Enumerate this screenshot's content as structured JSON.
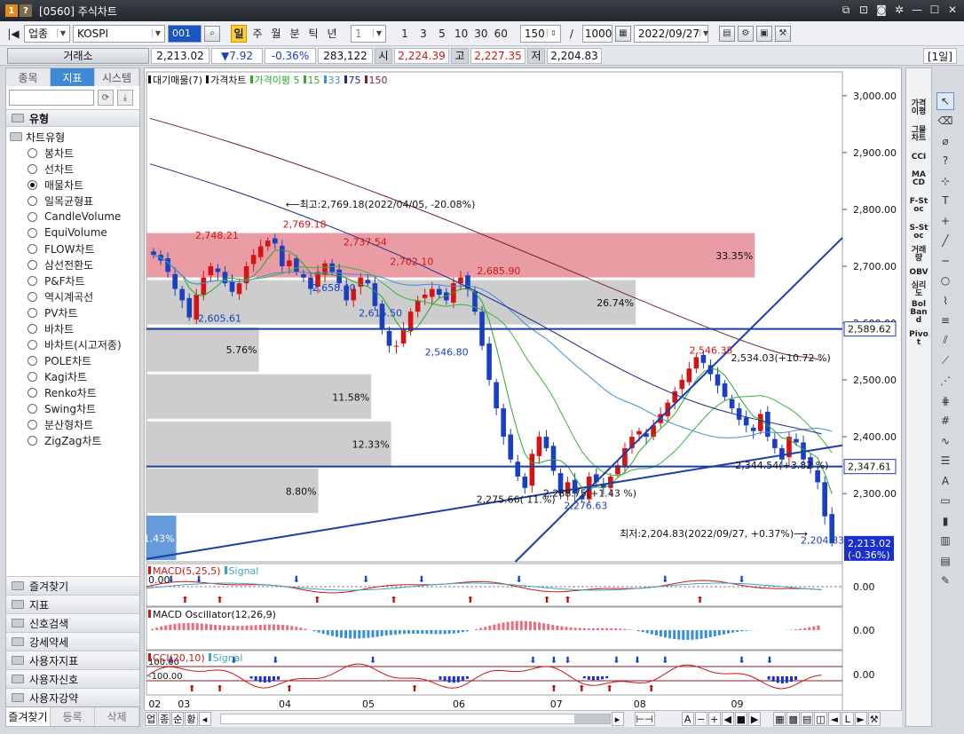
{
  "window": {
    "title": "[0560] 주식차트",
    "badge1": "1",
    "badge2": "?"
  },
  "toolbar": {
    "market": "업종",
    "symbol": "KOSPI",
    "code": "001",
    "periods": [
      "일",
      "주",
      "월",
      "분",
      "틱",
      "년"
    ],
    "interval": "1",
    "quick": [
      "1",
      "3",
      "5",
      "10",
      "30",
      "60"
    ],
    "count": "150",
    "total": "1000",
    "date": "2022/09/27"
  },
  "quote": {
    "exchange": "거래소",
    "price": "2,213.02",
    "change": "▼7.92",
    "pct": "-0.36%",
    "volume": "283,122",
    "open_label": "시",
    "open": "2,224.39",
    "high_label": "고",
    "high": "2,227.35",
    "low_label": "저",
    "low": "2,204.83",
    "period_tag": "[1일]"
  },
  "left": {
    "tabs": [
      "종목",
      "지표",
      "시스템"
    ],
    "section": "유형",
    "tree_root": "차트유형",
    "chart_types": [
      "봉차트",
      "선차트",
      "매물차트",
      "일목균형표",
      "CandleVolume",
      "EquiVolume",
      "FLOW차트",
      "삼선전환도",
      "P&F차트",
      "역시계곡선",
      "PV차트",
      "바차트",
      "바차트(시고저종)",
      "POLE차트",
      "Kagi차트",
      "Renko차트",
      "Swing차트",
      "분산형차트",
      "ZigZag차트"
    ],
    "selected": "매물차트",
    "categories": [
      "즐겨찾기",
      "지표",
      "신호검색",
      "강세약세",
      "사용자지표",
      "사용자신호",
      "사용자강약"
    ],
    "footer": [
      "즐겨찾기",
      "등록",
      "삭제"
    ]
  },
  "legend": {
    "main": [
      "대기매물(7)",
      "가격차트",
      "가격이평 5",
      "15",
      "33",
      "75",
      "150"
    ],
    "macd": [
      "MACD(5,25,5)",
      "Signal"
    ],
    "osc": [
      "MACD Oscillator(12,26,9)"
    ],
    "cci": [
      "CCI(20,10)",
      "Signal"
    ]
  },
  "colors": {
    "up": "#d41414",
    "down": "#1a3fbf",
    "ma5": "#2aa82a",
    "ma15": "#3aa53a",
    "ma33": "#3f8fd9",
    "ma75": "#1a2b8c",
    "ma150": "#7a2030",
    "trend": "#1a3fa8",
    "profile_hi": "#e7919a",
    "profile": "#c8c8c8",
    "profile_lo": "#4a8ad4"
  },
  "right_labels": [
    "가격이평",
    "그물차트",
    "CCI",
    "MACD",
    "F-Stoc",
    "S-Stoc",
    "거래량",
    "OBV",
    "심리도",
    "Bol Band",
    "Pivot"
  ],
  "bottom_buttons": [
    "업",
    "종",
    "순",
    "황"
  ],
  "chart_data": {
    "type": "candlestick",
    "x_labels": [
      "02",
      "03",
      "04",
      "05",
      "06",
      "07",
      "08",
      "09"
    ],
    "y_ticks": [
      "3,000.00",
      "2,900.00",
      "2,800.00",
      "2,700.00",
      "2,600.00",
      "2,500.00",
      "2,400.00",
      "2,300.00"
    ],
    "ylim": [
      2180,
      3020
    ],
    "current_price_label": "2,213.02",
    "current_pct_label": "(-0.36%)",
    "hline_labels": [
      "2,589.62",
      "2,347.61"
    ],
    "hlines": [
      2589.62,
      2347.61
    ],
    "volume_profile": [
      {
        "pct": "33.35%",
        "frac": 0.92,
        "hi": true
      },
      {
        "pct": "26.74%",
        "frac": 0.74
      },
      {
        "pct": "5.76%",
        "frac": 0.17
      },
      {
        "pct": "11.58%",
        "frac": 0.34
      },
      {
        "pct": "12.33%",
        "frac": 0.37
      },
      {
        "pct": "8.80%",
        "frac": 0.26
      },
      {
        "pct": "1.43%",
        "frac": 0.045,
        "lo": true
      }
    ],
    "price_labels": [
      {
        "text": "2,748.21",
        "x": 0.07,
        "y": 2748,
        "color": "up"
      },
      {
        "text": "2,769.18",
        "x": 0.196,
        "y": 2768,
        "color": "up"
      },
      {
        "text": "2,737.54",
        "x": 0.283,
        "y": 2737,
        "color": "up"
      },
      {
        "text": "2,702.10",
        "x": 0.35,
        "y": 2702,
        "color": "up"
      },
      {
        "text": "2,685.90",
        "x": 0.475,
        "y": 2686,
        "color": "up"
      },
      {
        "text": "2,658.40",
        "x": 0.238,
        "y": 2656,
        "color": "down"
      },
      {
        "text": "2,605.61",
        "x": 0.074,
        "y": 2602,
        "color": "down"
      },
      {
        "text": "2,615.50",
        "x": 0.305,
        "y": 2612,
        "color": "down"
      },
      {
        "text": "2,546.80",
        "x": 0.4,
        "y": 2543,
        "color": "down"
      },
      {
        "text": "2,546.35",
        "x": 0.78,
        "y": 2546,
        "color": "up"
      },
      {
        "text": "2,276.63",
        "x": 0.6,
        "y": 2273,
        "color": "down"
      },
      {
        "text": "2,204.83",
        "x": 0.94,
        "y": 2212,
        "color": "down"
      }
    ],
    "annotations": [
      {
        "text": "⟵최고:2,769.18(2022/04/05, -20.08%)",
        "x": 0.2,
        "y": 2803
      },
      {
        "text": "2,534.03(+10.72 %)",
        "x": 0.84,
        "y": 2533
      },
      {
        "text": "2,344.54(+3.82 %)",
        "x": 0.846,
        "y": 2344
      },
      {
        "text": "2,275.66( 11.%)",
        "x": 0.474,
        "y": 2284
      },
      {
        "text": "2,288.75(+1.43 %)",
        "x": 0.57,
        "y": 2295
      },
      {
        "text": "최저:2,204.83(2022/09/27, +0.37%)⟶",
        "x": 0.68,
        "y": 2224
      }
    ],
    "sub_value_labels": [
      "0.00",
      "0.00",
      "0.00"
    ],
    "sub_ref_labels": [
      "0.00",
      "100.00",
      "-100.00"
    ],
    "close_path": [
      2720,
      2710,
      2690,
      2660,
      2640,
      2610,
      2650,
      2680,
      2700,
      2690,
      2670,
      2655,
      2670,
      2700,
      2720,
      2735,
      2745,
      2740,
      2700,
      2710,
      2690,
      2680,
      2660,
      2690,
      2705,
      2690,
      2670,
      2640,
      2660,
      2680,
      2670,
      2630,
      2590,
      2560,
      2560,
      2590,
      2620,
      2640,
      2650,
      2660,
      2650,
      2640,
      2670,
      2680,
      2660,
      2620,
      2560,
      2500,
      2450,
      2400,
      2360,
      2330,
      2310,
      2370,
      2400,
      2380,
      2340,
      2300,
      2320,
      2300,
      2290,
      2330,
      2320,
      2310,
      2330,
      2350,
      2380,
      2400,
      2410,
      2400,
      2420,
      2440,
      2460,
      2480,
      2500,
      2520,
      2540,
      2530,
      2510,
      2490,
      2470,
      2450,
      2430,
      2420,
      2410,
      2440,
      2400,
      2380,
      2360,
      2400,
      2390,
      2360,
      2345,
      2320,
      2260,
      2213
    ]
  }
}
